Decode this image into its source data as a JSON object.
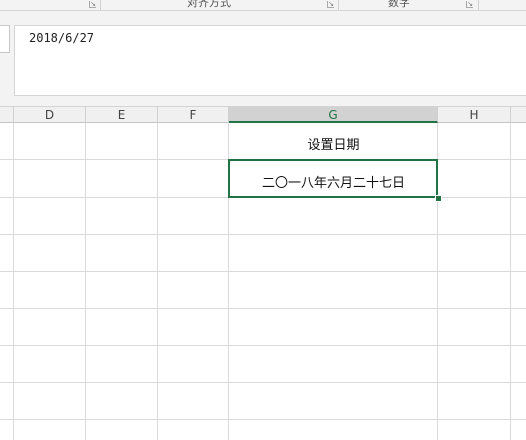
{
  "ribbon": {
    "groups": [
      {
        "label": "对齐方式"
      },
      {
        "label": "数字"
      }
    ]
  },
  "formula_bar": {
    "value": "2018/6/27"
  },
  "columns": [
    "D",
    "E",
    "F",
    "G",
    "H"
  ],
  "selected_column": "G",
  "cells": {
    "g1": "设置日期",
    "g2": "二〇一八年六月二十七日"
  },
  "colors": {
    "accent": "#217346",
    "gridline": "#dadada",
    "header_bg": "#f0f0f0"
  }
}
